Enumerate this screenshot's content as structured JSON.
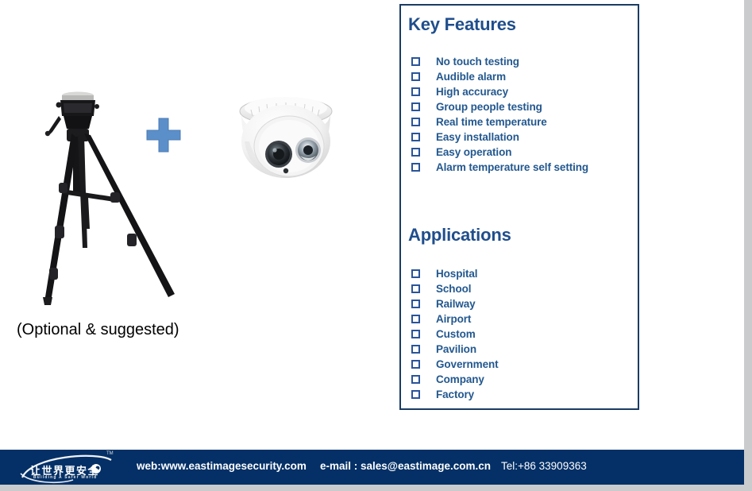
{
  "page": {
    "background": "#ffffff",
    "accent_navy": "#1b3c63",
    "accent_blue": "#23588f",
    "footer_navy": "#043067",
    "plus_blue": "#5b8fc9"
  },
  "product": {
    "tripod_icon": "camera-tripod",
    "plus_icon": "plus-icon",
    "camera_icon": "dome-security-camera",
    "caption": "(Optional & suggested)"
  },
  "panel": {
    "key_features": {
      "title": "Key Features",
      "items": [
        "No touch testing",
        "Audible alarm",
        "High accuracy",
        "Group people testing",
        "Real time temperature",
        "Easy installation",
        "Easy operation",
        "Alarm temperature self setting"
      ]
    },
    "applications": {
      "title": "Applications",
      "items": [
        "Hospital",
        "School",
        "Railway",
        "Airport",
        "Custom",
        "Pavilion",
        "Government",
        "Company",
        "Factory"
      ]
    }
  },
  "footer": {
    "logo": {
      "chinese": "让世界更安全",
      "tagline": "Building A Safer World",
      "trademark": "TM"
    },
    "web": "web:www.eastimagesecurity.com",
    "email": "e-mail : sales@eastimage.com.cn",
    "tel": "Tel:+86 33909363"
  }
}
